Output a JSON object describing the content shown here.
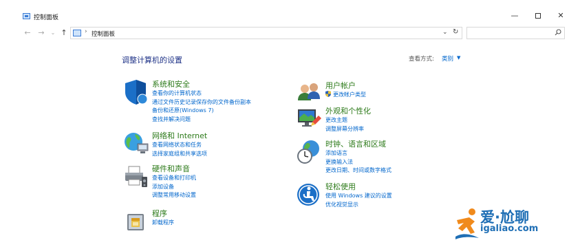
{
  "window": {
    "title": "控制面板",
    "minimize": "—",
    "close": "✕"
  },
  "navbar": {
    "back": "←",
    "forward": "→",
    "recent": "⌄",
    "up": "↑",
    "separator": "›",
    "breadcrumb": "控制面板",
    "dropdown": "⌄",
    "refresh": "↻",
    "search_value": ""
  },
  "main": {
    "title": "调整计算机的设置",
    "view_by_label": "查看方式:",
    "view_by_value": "类别",
    "view_by_caret": "▼",
    "categories": [
      {
        "title": "系统和安全",
        "icon": "shield-icon",
        "links": [
          "查看你的计算机状态",
          "通过文件历史记录保存你的文件备份副本",
          "备份和还原(Windows 7)",
          "查找并解决问题"
        ]
      },
      {
        "title": "网络和 Internet",
        "icon": "globe-network-icon",
        "links": [
          "查看网络状态和任务",
          "选择家庭组和共享选项"
        ]
      },
      {
        "title": "硬件和声音",
        "icon": "printer-icon",
        "links": [
          "查看设备和打印机",
          "添加设备",
          "调整常用移动设置"
        ]
      },
      {
        "title": "程序",
        "icon": "programs-icon",
        "links": [
          "卸载程序"
        ]
      },
      {
        "title": "用户帐户",
        "icon": "users-icon",
        "links": [
          "更改帐户类型"
        ]
      },
      {
        "title": "外观和个性化",
        "icon": "monitor-icon",
        "links": [
          "更改主题",
          "调整屏幕分辨率"
        ]
      },
      {
        "title": "时钟、语言和区域",
        "icon": "clock-globe-icon",
        "links": [
          "添加语言",
          "更换输入法",
          "更改日期、时间或数字格式"
        ]
      },
      {
        "title": "轻松使用",
        "icon": "accessibility-icon",
        "links": [
          "使用 Windows 建议的设置",
          "优化视觉显示"
        ]
      }
    ]
  },
  "watermark": {
    "text": "爱·尬聊",
    "sub": "igaliao.com"
  },
  "colors": {
    "category_title": "#2c7a19",
    "link": "#0066cc",
    "page_title": "#1e3287",
    "watermark": "#1f6fb5",
    "watermark_accent": "#f08a1c"
  }
}
